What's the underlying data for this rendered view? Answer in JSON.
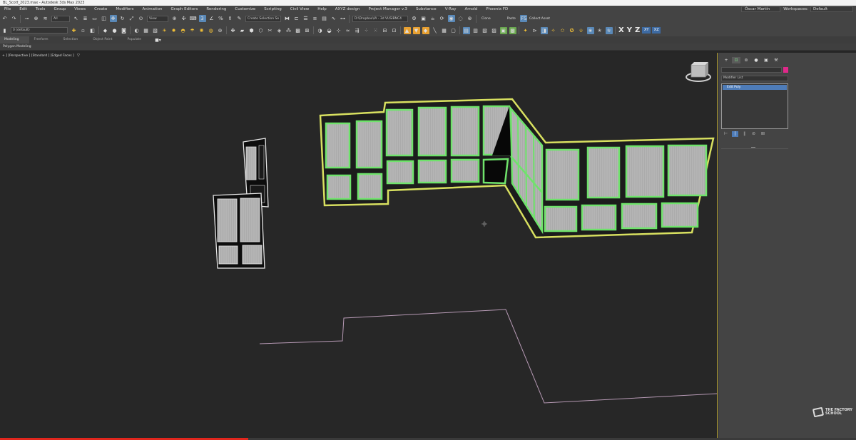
{
  "window": {
    "title": "BL_Scott_2023.max - Autodesk 3ds Max 2023"
  },
  "menu": {
    "items": [
      "File",
      "Edit",
      "Tools",
      "Group",
      "Views",
      "Create",
      "Modifiers",
      "Animation",
      "Graph Editors",
      "Rendering",
      "Customize",
      "Scripting",
      "Civil View",
      "Help",
      "AXYZ design",
      "Project Manager v.3",
      "Substance",
      "V-Ray",
      "Arnold",
      "Phoenix FD"
    ],
    "user": "Óscar Martín",
    "workspaces_label": "Workspaces:",
    "workspace": "Default"
  },
  "toolbar1": {
    "filter": "All",
    "view": "View",
    "selection_set": "Create Selection Se",
    "render_preset": "D:\\Dropbox\\IA - 3d VUSIBNC4",
    "clone_label": "Clone",
    "paste_label": "Paste",
    "collect_asset_label": "Collect Asset"
  },
  "toolbar2": {
    "layer": "0 (default)",
    "axis_x": "X",
    "axis_y": "Y",
    "axis_z": "Z",
    "btn_xy": "XY",
    "btn_xz": "XZ"
  },
  "ribbon": {
    "tabs": [
      "Modeling",
      "Freeform",
      "Selection",
      "Object Paint",
      "Populate"
    ],
    "active_tab": "Modeling",
    "sub_label": "Polygon Modeling"
  },
  "viewport": {
    "label": "+ ] [Perspective ] [Standard ] [Edged Faces ]",
    "filter_icon": "funnel-icon",
    "selection_color": "#6fe36b",
    "spline_color": "#b79ab5"
  },
  "command_panel": {
    "tabs": [
      "+",
      "⊡",
      "⊜",
      "●",
      "▣",
      "⚒"
    ],
    "active_tab": 1,
    "object_color": "#e0288a",
    "modifier_list_label": "Modifier List",
    "stack_items": [
      "Edit Poly"
    ],
    "stack_tools": [
      "⊢",
      "|",
      "∥",
      "⊘",
      "⊞"
    ]
  },
  "watermark": {
    "text": "THE FACTORY SCHOOL"
  },
  "video_progress": 0.29
}
